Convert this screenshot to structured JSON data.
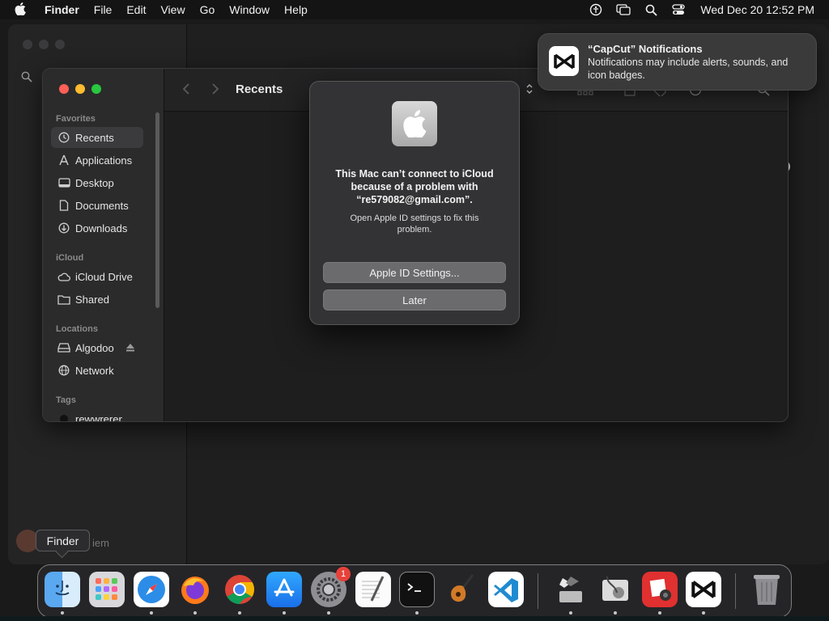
{
  "menubar": {
    "app": "Finder",
    "items": [
      "File",
      "Edit",
      "View",
      "Go",
      "Window",
      "Help"
    ],
    "clock": "Wed Dec 20  12:52 PM"
  },
  "background_window": {
    "partial_name": "iem"
  },
  "finder": {
    "title": "Recents",
    "sections": {
      "favorites": "Favorites",
      "icloud": "iCloud",
      "locations": "Locations",
      "tags": "Tags"
    },
    "favorites": [
      "Recents",
      "Applications",
      "Desktop",
      "Documents",
      "Downloads"
    ],
    "icloud_items": [
      "iCloud Drive",
      "Shared"
    ],
    "locations": [
      "Algodoo",
      "Network"
    ],
    "tags": [
      "rewwrerer"
    ]
  },
  "dialog": {
    "message": "This Mac can’t connect to iCloud because of a problem with “re579082@gmail.com”.",
    "sub": "Open Apple ID settings to fix this problem.",
    "primary_button": "Apple ID Settings...",
    "secondary_button": "Later"
  },
  "notification": {
    "title": "“CapCut” Notifications",
    "body": "Notifications may include alerts, sounds, and icon badges."
  },
  "tooltip": "Finder",
  "dock": {
    "badge": "1",
    "apps": [
      "finder-icon",
      "launchpad-icon",
      "safari-icon",
      "firefox-icon",
      "chrome-icon",
      "app-store-icon",
      "system-settings-icon",
      "textedit-icon",
      "terminal-icon",
      "garageband-icon",
      "vscode-icon",
      "boot-camp-icon",
      "disk-utility-icon",
      "photo-booth-icon",
      "capcut-icon",
      "trash-icon"
    ]
  },
  "colors": {
    "close": "#ff5f57",
    "minimize": "#febc2e",
    "zoom": "#28c840",
    "badge": "#e8413a"
  }
}
